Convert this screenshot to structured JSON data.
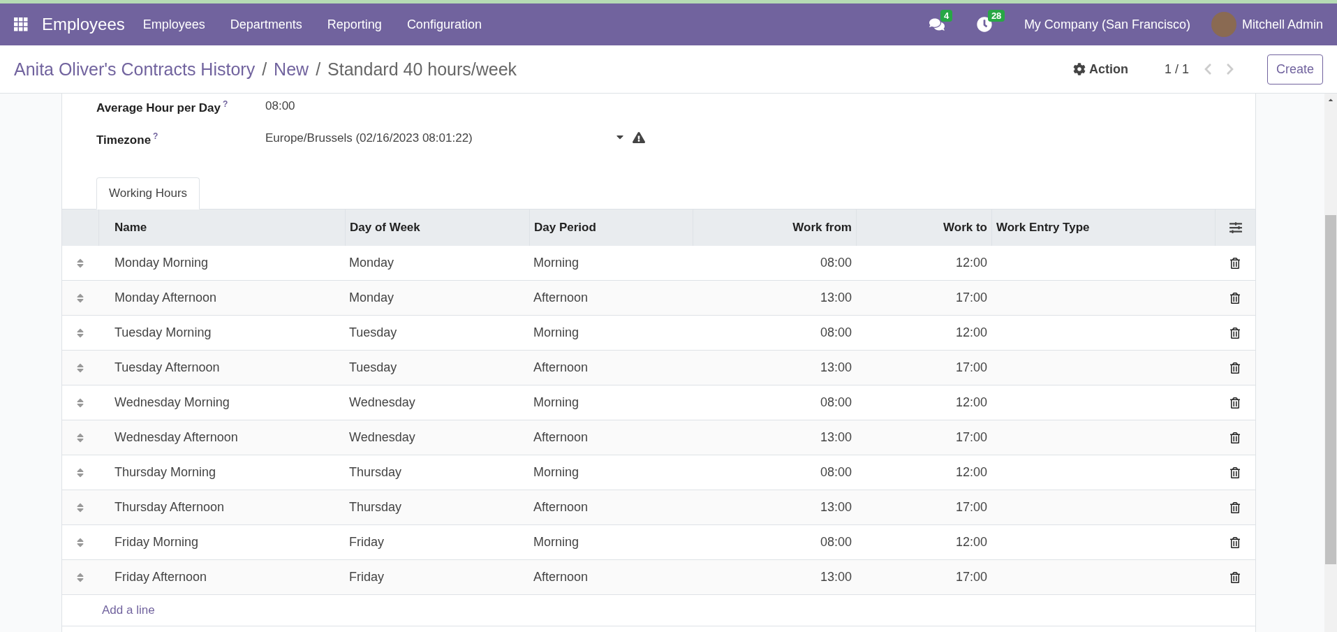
{
  "navbar": {
    "app_name": "Employees",
    "menu": [
      "Employees",
      "Departments",
      "Reporting",
      "Configuration"
    ],
    "messages_count": "4",
    "activities_count": "28",
    "company": "My Company (San Francisco)",
    "user": "Mitchell Admin"
  },
  "breadcrumb_separator": "/",
  "breadcrumbs": [
    {
      "label": "Anita Oliver's Contracts History",
      "current": false
    },
    {
      "label": "New",
      "current": false
    },
    {
      "label": "Standard 40 hours/week",
      "current": true
    }
  ],
  "control_panel": {
    "action": "Action",
    "pager": "1 / 1",
    "create": "Create"
  },
  "fields": [
    {
      "label": "Average Hour per Day",
      "help": "?",
      "value": "08:00",
      "kind": "text"
    },
    {
      "label": "Timezone",
      "help": "?",
      "value": "Europe/Brussels (02/16/2023 08:01:22)",
      "kind": "select"
    }
  ],
  "tabs": [
    {
      "label": "Working Hours",
      "selected": true
    }
  ],
  "table": {
    "columns": [
      "Name",
      "Day of Week",
      "Day Period",
      "Work from",
      "Work to",
      "Work Entry Type"
    ],
    "rows": [
      [
        "Monday Morning",
        "Monday",
        "Morning",
        "08:00",
        "12:00"
      ],
      [
        "Monday Afternoon",
        "Monday",
        "Afternoon",
        "13:00",
        "17:00"
      ],
      [
        "Tuesday Morning",
        "Tuesday",
        "Morning",
        "08:00",
        "12:00"
      ],
      [
        "Tuesday Afternoon",
        "Tuesday",
        "Afternoon",
        "13:00",
        "17:00"
      ],
      [
        "Wednesday Morning",
        "Wednesday",
        "Morning",
        "08:00",
        "12:00"
      ],
      [
        "Wednesday Afternoon",
        "Wednesday",
        "Afternoon",
        "13:00",
        "17:00"
      ],
      [
        "Thursday Morning",
        "Thursday",
        "Morning",
        "08:00",
        "12:00"
      ],
      [
        "Thursday Afternoon",
        "Thursday",
        "Afternoon",
        "13:00",
        "17:00"
      ],
      [
        "Friday Morning",
        "Friday",
        "Morning",
        "08:00",
        "12:00"
      ],
      [
        "Friday Afternoon",
        "Friday",
        "Afternoon",
        "13:00",
        "17:00"
      ]
    ],
    "add_line": "Add a line"
  }
}
